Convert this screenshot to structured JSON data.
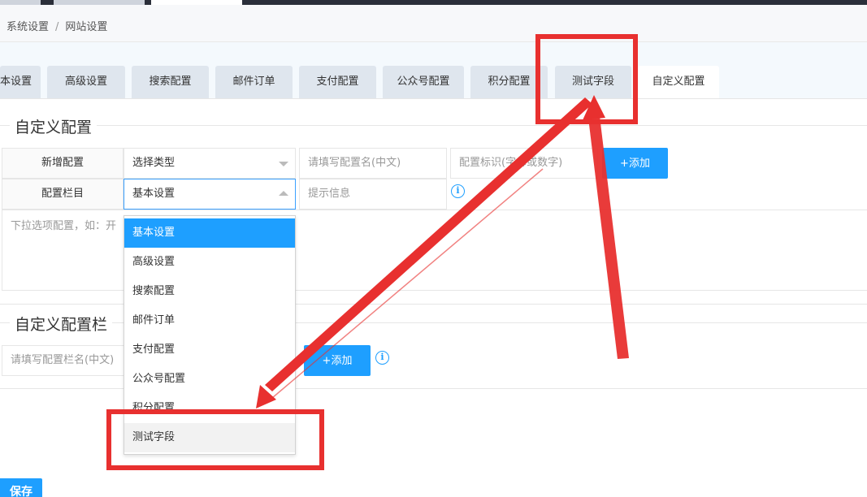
{
  "breadcrumb": {
    "items": [
      "系统设置",
      "网站设置"
    ],
    "separator": "/"
  },
  "tabs": [
    {
      "label": "本设置",
      "active": false
    },
    {
      "label": "高级设置",
      "active": false
    },
    {
      "label": "搜索配置",
      "active": false
    },
    {
      "label": "邮件订单",
      "active": false
    },
    {
      "label": "支付配置",
      "active": false
    },
    {
      "label": "公众号配置",
      "active": false
    },
    {
      "label": "积分配置",
      "active": false
    },
    {
      "label": "测试字段",
      "active": false
    },
    {
      "label": "自定义配置",
      "active": true
    }
  ],
  "custom_config": {
    "legend": "自定义配置",
    "row1": {
      "label": "新增配置",
      "type_select": "选择类型",
      "name_placeholder": "请填写配置名(中文)",
      "key_placeholder": "配置标识(字母或数字)",
      "add_button": "+添加"
    },
    "row2": {
      "label": "配置栏目",
      "column_select": "基本设置",
      "hint_placeholder": "提示信息"
    },
    "options_placeholder": "下拉选项配置，如：开"
  },
  "dropdown": {
    "options": [
      "基本设置",
      "高级设置",
      "搜索配置",
      "邮件订单",
      "支付配置",
      "公众号配置",
      "积分配置",
      "测试字段"
    ],
    "selected": "基本设置",
    "hovered": "测试字段"
  },
  "custom_column": {
    "legend": "自定义配置栏",
    "name_placeholder": "请填写配置栏名(中文)",
    "add_button": "+添加"
  },
  "save_button": "保存",
  "colors": {
    "accent": "#1e9fff",
    "annotation": "#e8302f",
    "tab_bg": "#dfe6ee"
  },
  "icons": {
    "info": "info-icon",
    "caret": "caret-icon"
  }
}
